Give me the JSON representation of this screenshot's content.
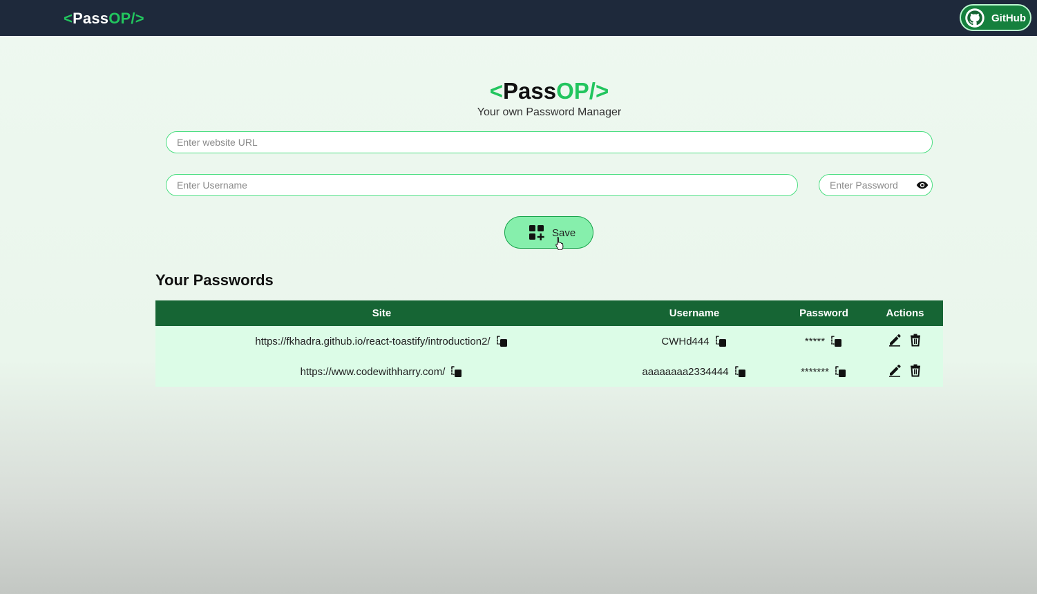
{
  "navbar": {
    "logo_prefix": "<",
    "logo_main": "Pass",
    "logo_accent": "OP/>",
    "github_label": "GitHub"
  },
  "hero": {
    "brand_prefix": "<",
    "brand_main": "Pass",
    "brand_accent": "OP/>",
    "subtitle": "Your own Password Manager"
  },
  "form": {
    "url_placeholder": "Enter website URL",
    "username_placeholder": "Enter Username",
    "password_placeholder": "Enter Password",
    "save_label": "Save"
  },
  "passwords": {
    "title": "Your Passwords",
    "columns": [
      "Site",
      "Username",
      "Password",
      "Actions"
    ],
    "rows": [
      {
        "site": "https://fkhadra.github.io/react-toastify/introduction2/",
        "username": "CWHd444",
        "password": "*****"
      },
      {
        "site": "https://www.codewithharry.com/",
        "username": "aaaaaaaa2334444",
        "password": "*******"
      }
    ]
  },
  "colors": {
    "navbar_bg": "#1e293b",
    "accent_green": "#22c55e",
    "table_header": "#166534",
    "table_row": "#dcfce7",
    "save_button": "#86efac"
  },
  "icons": [
    "github-icon",
    "eye-icon",
    "add-grid-icon",
    "copy-icon",
    "edit-icon",
    "delete-icon",
    "cursor-icon"
  ]
}
